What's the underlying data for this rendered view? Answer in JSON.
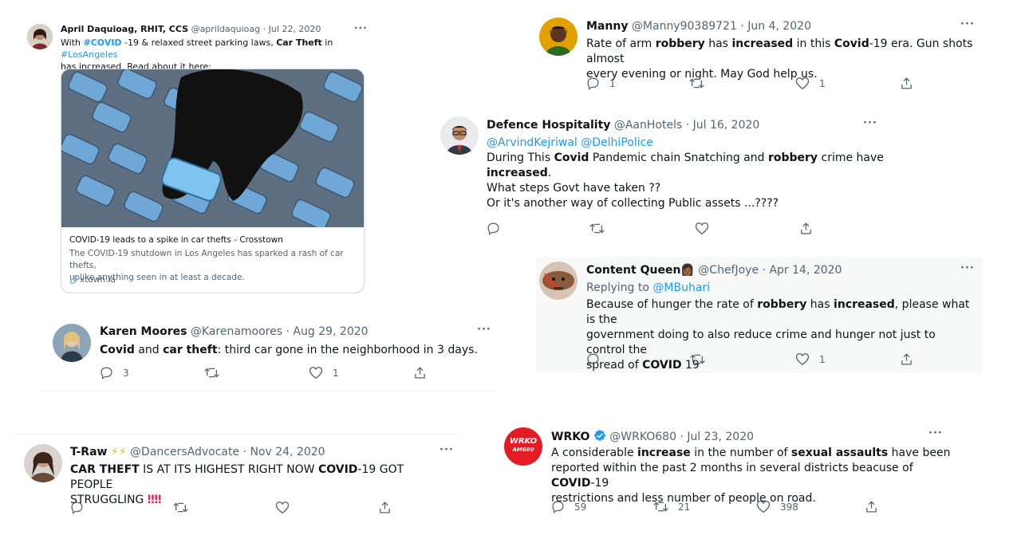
{
  "t1": {
    "name": "April Daquioag, RHIT, CCS",
    "handle": "@aprildaquioag",
    "dot": "·",
    "date": "Jul 22, 2020",
    "more": "···",
    "text": {
      "a": "With ",
      "tag1": "#COVID",
      "b": " -19 & relaxed street parking laws, ",
      "bold1": "Car Theft",
      "c": " in ",
      "tag2": "#LosAngeles",
      "d": "has increased.  Read about it here:"
    },
    "card": {
      "title": "COVID-19 leads to a spike in car thefts - Crosstown",
      "desc1": "The COVID-19 shutdown in Los Angeles has sparked a rash of car thefts,",
      "desc2": "unlike anything seen in at least a decade.",
      "domain": "xtown.la"
    }
  },
  "t2": {
    "name": "Karen Moores",
    "handle": "@Karenamoores",
    "dot": "·",
    "date": "Aug 29, 2020",
    "more": "···",
    "text": {
      "bold1": "Covid",
      "a": " and ",
      "bold2": "car theft",
      "b": ": third car gone in the neighborhood in 3 days."
    },
    "replies": "3",
    "likes": "1"
  },
  "t3": {
    "name": "T-Raw",
    "emoji": "⚡⚡",
    "handle": "@DancersAdvocate",
    "dot": "·",
    "date": "Nov 24, 2020",
    "more": "···",
    "text": {
      "bold1": "CAR THEFT",
      "a": " IS AT ITS HIGHEST RIGHT NOW ",
      "bold2": "COVID",
      "b": "-19 GOT PEOPLE",
      "c": "STRUGGLING",
      "emoji": "‼‼"
    }
  },
  "t4": {
    "name": "Manny",
    "handle": "@Manny90389721",
    "dot": "·",
    "date": "Jun 4, 2020",
    "more": "···",
    "text": {
      "a": "Rate of arm ",
      "bold1": "robbery",
      "b": " has ",
      "bold2": "increased",
      "c": " in this ",
      "bold3": "Covid",
      "d": "-19 era. Gun shots almost",
      "e": "every evening or night. May God help us."
    },
    "replies": "1",
    "likes": "1"
  },
  "t5": {
    "name": "Defence Hospitality",
    "handle": "@AanHotels",
    "dot": "·",
    "date": "Jul 16, 2020",
    "more": "···",
    "mentions": "@ArvindKejriwal @DelhiPolice",
    "text": {
      "a": "During This ",
      "bold1": "Covid",
      "b": " Pandemic chain Snatching and ",
      "bold2": "robbery",
      "c": " crime have",
      "bold3": "increased",
      "d": ".",
      "line3": "What steps Govt have taken ??",
      "line4": "Or it's another way of collecting Public assets ...????"
    }
  },
  "t6": {
    "name": "Content Queen",
    "emoji": "👩🏾",
    "handle": "@ChefJoye",
    "dot": "·",
    "date": "Apr 14, 2020",
    "more": "···",
    "reply_prefix": "Replying to ",
    "reply_to": "@MBuhari",
    "text": {
      "a": "Because of hunger the rate of ",
      "bold1": "robbery",
      "b": " has ",
      "bold2": "increased",
      "c": ", please what is the",
      "d": "government doing to also reduce crime and hunger not just to control the",
      "e": "spread of ",
      "bold3": "COVID",
      "f": " 19"
    },
    "likes": "1"
  },
  "t7": {
    "name": "WRKO",
    "handle": "@WRKO680",
    "dot": "·",
    "date": "Jul 23, 2020",
    "more": "···",
    "logo_text": "WRKO",
    "logo_sub": "AM680",
    "text": {
      "a": "A considerable ",
      "bold1": "increase",
      "b": " in the number of ",
      "bold2": "sexual assaults",
      "c": " have been",
      "d": "reported within the past 2 months in several districts beacuse of ",
      "bold3": "COVID",
      "e": "-19",
      "f": "restrictions and less number of people on road."
    },
    "replies": "59",
    "retweets": "21",
    "likes": "398"
  },
  "colors": {
    "link": "#1d9bf0",
    "meta": "#536471",
    "verified": "#1d9bf0",
    "wrko_red": "#e31b23"
  },
  "icons": [
    "reply-icon",
    "retweet-icon",
    "like-icon",
    "share-icon",
    "more-icon",
    "link-icon",
    "verified-icon"
  ]
}
